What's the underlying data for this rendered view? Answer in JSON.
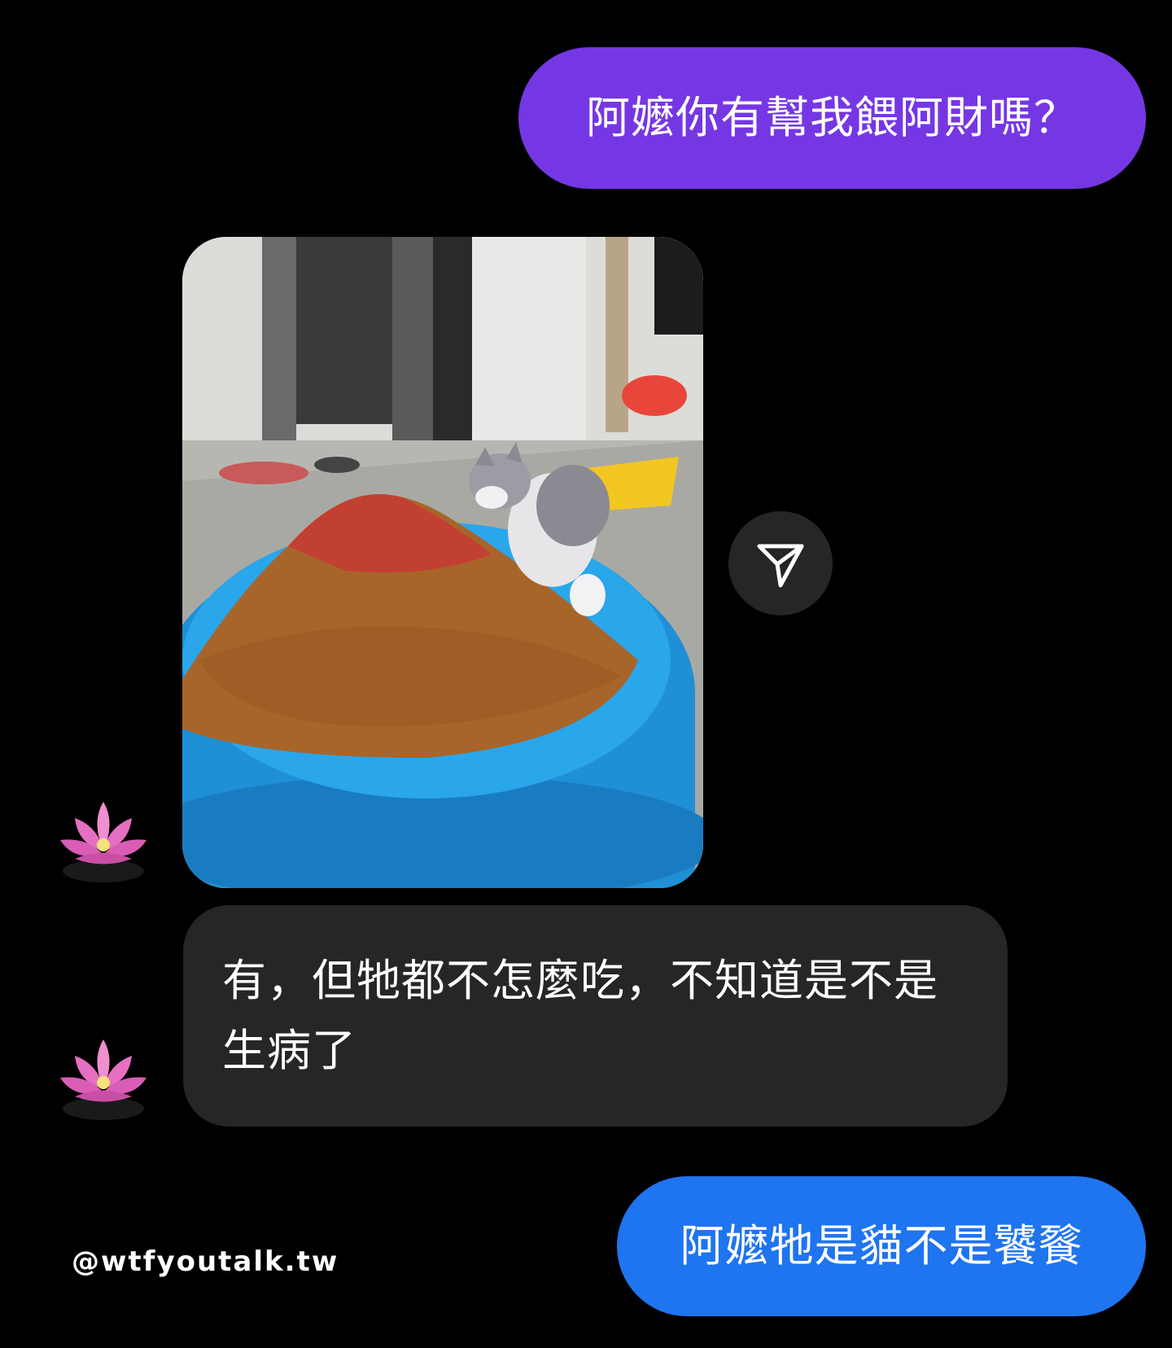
{
  "messages": [
    {
      "direction": "outgoing",
      "text": "阿嬤你有幫我餵阿財嗎？",
      "bubble_color": "#7537e3"
    },
    {
      "direction": "incoming",
      "type": "image",
      "image_description_icon": "photo-icon"
    },
    {
      "direction": "incoming",
      "text": "有，但牠都不怎麼吃，不知道是不是生病了",
      "bubble_color": "#262626"
    },
    {
      "direction": "outgoing",
      "text": "阿嬤牠是貓不是饕餮",
      "bubble_color": "#1f74ef"
    }
  ],
  "share_button": {
    "icon": "send-icon"
  },
  "contact": {
    "avatar_icon": "lotus-flower-avatar"
  },
  "watermark": {
    "text": "@wtfyoutalk.tw"
  },
  "colors": {
    "background": "#000000",
    "outgoing_purple": "#7537e3",
    "outgoing_blue": "#1f74ef",
    "incoming_gray": "#262626"
  }
}
